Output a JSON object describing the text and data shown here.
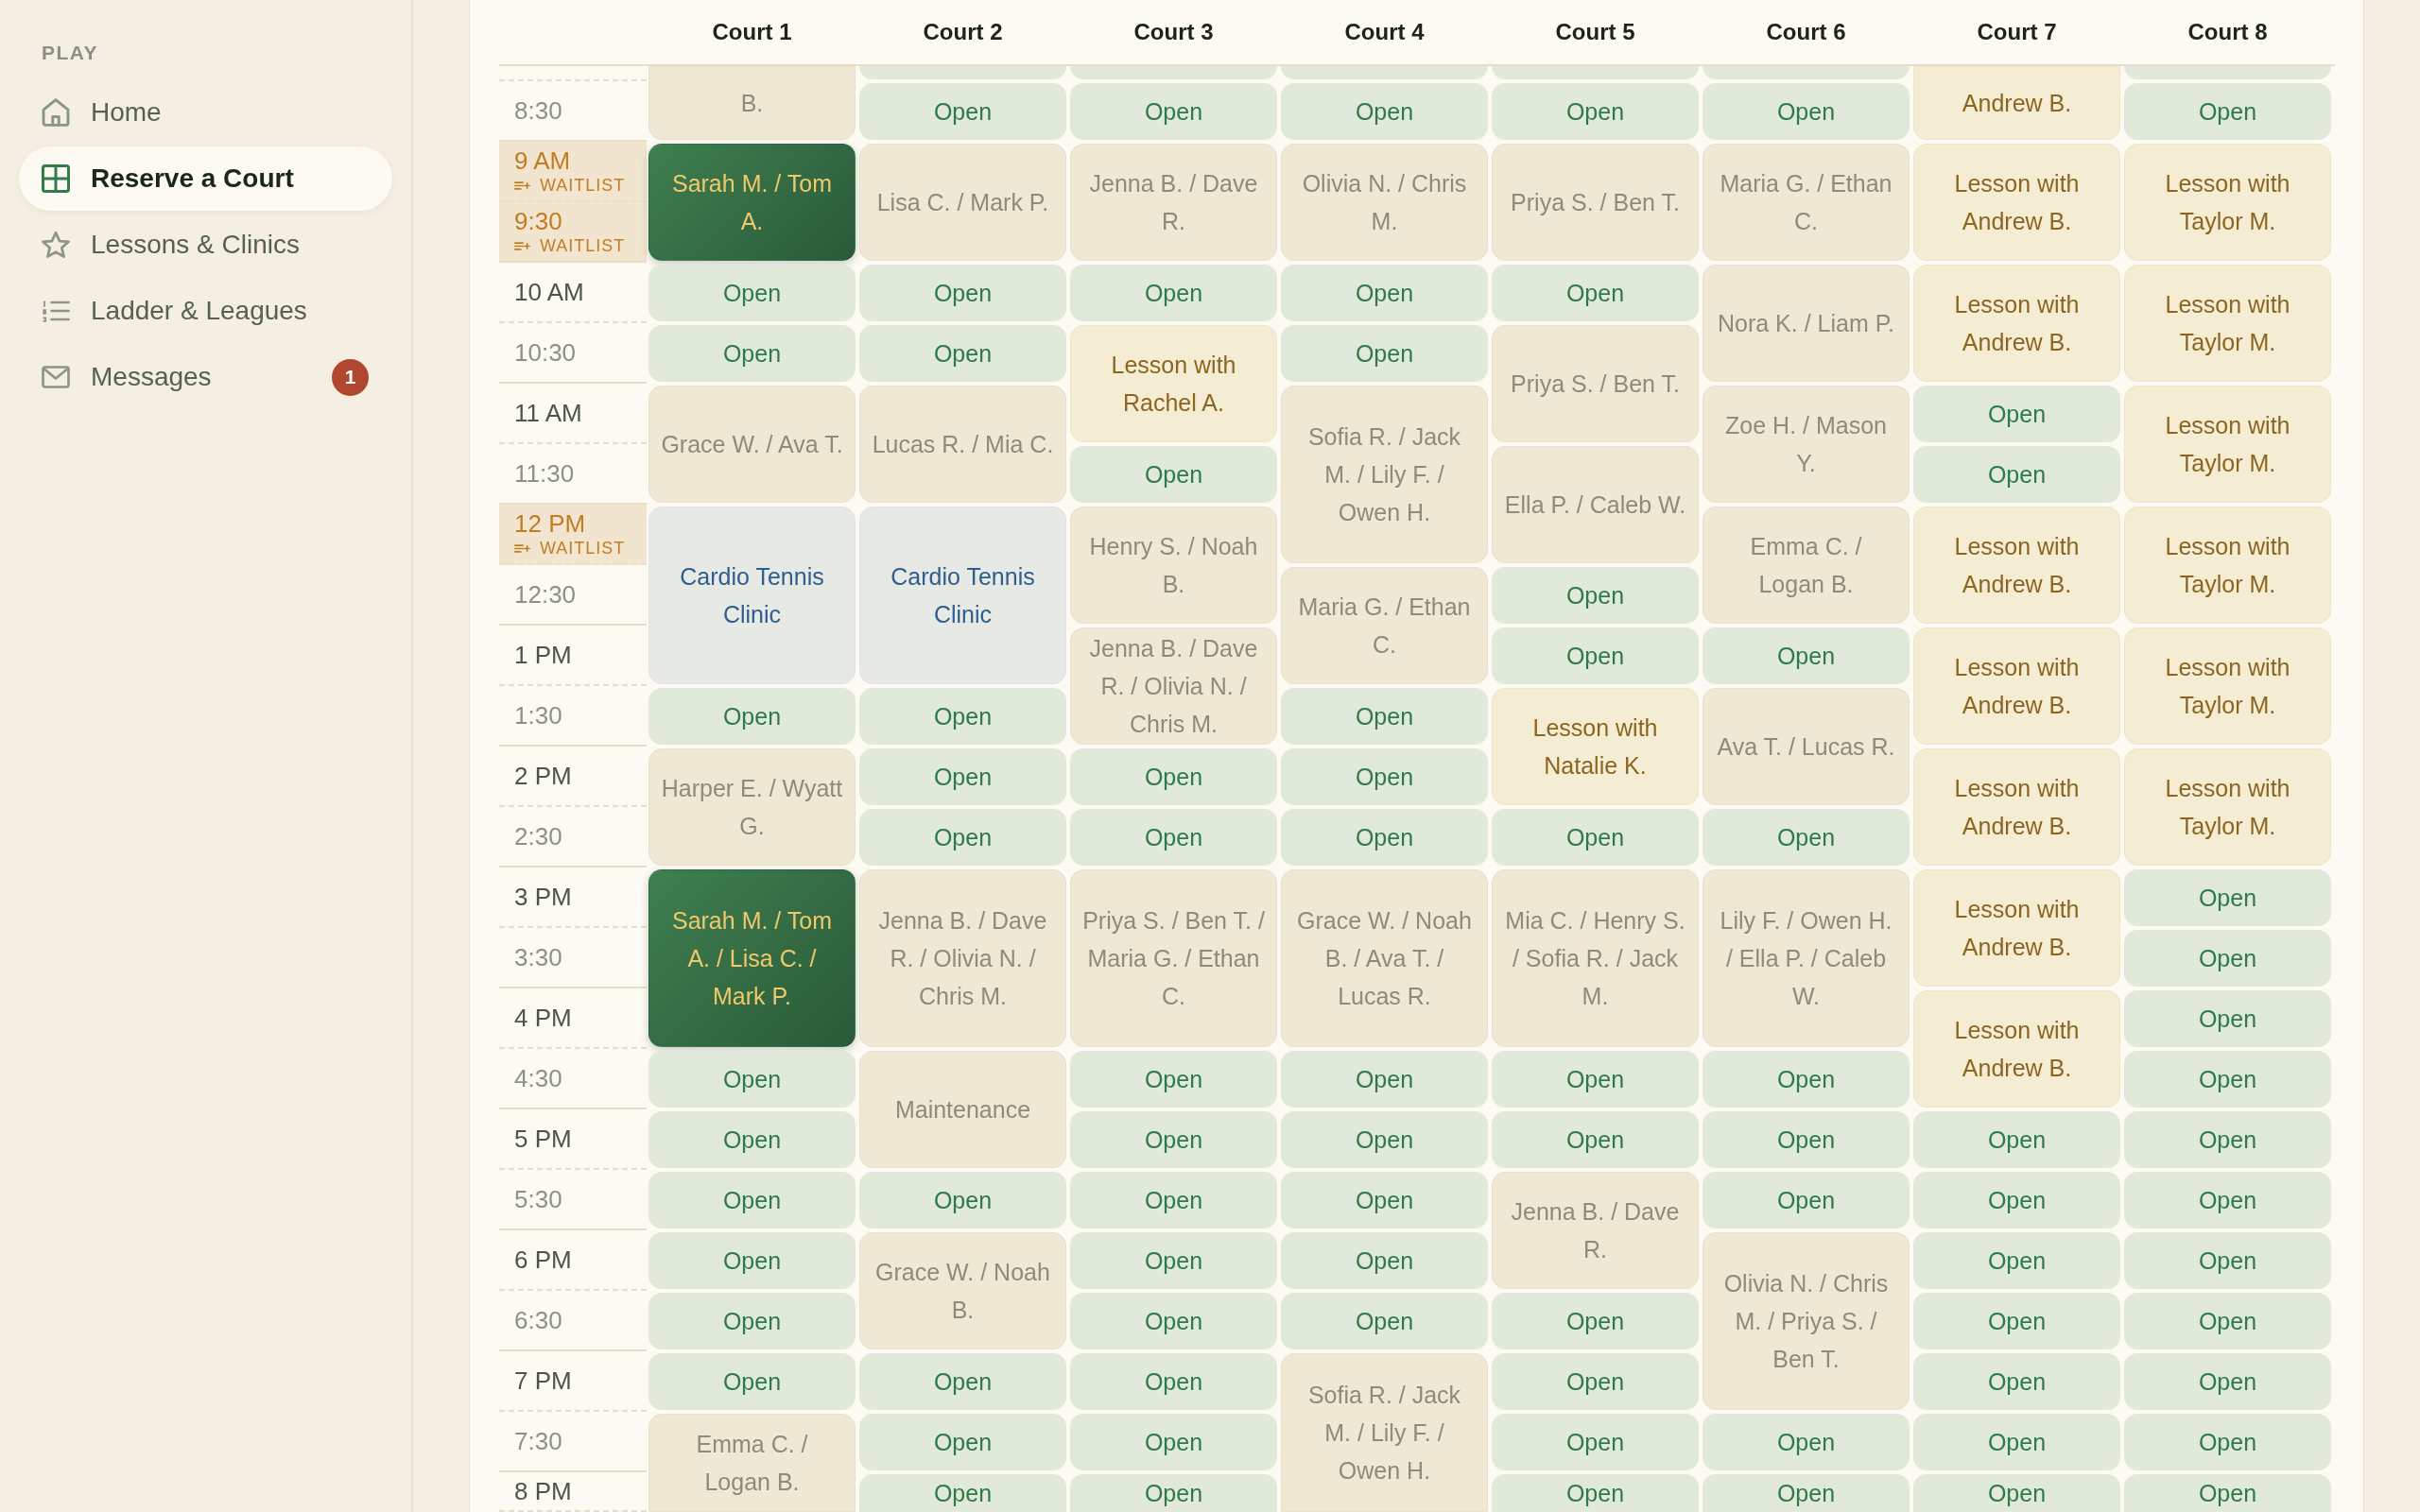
{
  "sidebar": {
    "section_label": "PLAY",
    "items": [
      {
        "label": "Home",
        "selected": false
      },
      {
        "label": "Reserve a Court",
        "selected": true
      },
      {
        "label": "Lessons & Clinics",
        "selected": false
      },
      {
        "label": "Ladder & Leagues",
        "selected": false
      },
      {
        "label": "Messages",
        "selected": false,
        "badge": "1"
      }
    ]
  },
  "schedule": {
    "time_slots": [
      {
        "time": "8:30",
        "kind": "half"
      },
      {
        "time": "9 AM",
        "kind": "hour",
        "waitlist": "WAITLIST"
      },
      {
        "time": "9:30",
        "kind": "half",
        "waitlist": "WAITLIST"
      },
      {
        "time": "10 AM",
        "kind": "hour"
      },
      {
        "time": "10:30",
        "kind": "half"
      },
      {
        "time": "11 AM",
        "kind": "hour"
      },
      {
        "time": "11:30",
        "kind": "half"
      },
      {
        "time": "12 PM",
        "kind": "hour",
        "waitlist": "WAITLIST"
      },
      {
        "time": "12:30",
        "kind": "half"
      },
      {
        "time": "1 PM",
        "kind": "hour"
      },
      {
        "time": "1:30",
        "kind": "half"
      },
      {
        "time": "2 PM",
        "kind": "hour"
      },
      {
        "time": "2:30",
        "kind": "half"
      },
      {
        "time": "3 PM",
        "kind": "hour"
      },
      {
        "time": "3:30",
        "kind": "half"
      },
      {
        "time": "4 PM",
        "kind": "hour"
      },
      {
        "time": "4:30",
        "kind": "half"
      },
      {
        "time": "5 PM",
        "kind": "hour"
      },
      {
        "time": "5:30",
        "kind": "half"
      },
      {
        "time": "6 PM",
        "kind": "hour"
      },
      {
        "time": "6:30",
        "kind": "half"
      },
      {
        "time": "7 PM",
        "kind": "hour"
      },
      {
        "time": "7:30",
        "kind": "half"
      },
      {
        "time": "8 PM",
        "kind": "hour"
      }
    ],
    "courts": [
      {
        "name": "Court 1",
        "slots": [
          {
            "kind": "booked",
            "text": "B."
          },
          {
            "kind": "continued"
          },
          {
            "kind": "mine",
            "text": "Sarah M. / Tom A."
          },
          {
            "kind": "continued"
          },
          {
            "kind": "open",
            "text": "Open"
          },
          {
            "kind": "open",
            "text": "Open"
          },
          {
            "kind": "booked",
            "text": "Grace W. / Ava T."
          },
          {
            "kind": "continued"
          },
          {
            "kind": "clinic",
            "text": "Cardio Tennis Clinic"
          },
          {
            "kind": "continued"
          },
          {
            "kind": "continued"
          },
          {
            "kind": "open",
            "text": "Open"
          },
          {
            "kind": "booked",
            "text": "Harper E. / Wyatt G."
          },
          {
            "kind": "continued"
          },
          {
            "kind": "mine",
            "text": "Sarah M. / Tom A. / Lisa C. / Mark P."
          },
          {
            "kind": "continued"
          },
          {
            "kind": "continued"
          },
          {
            "kind": "open",
            "text": "Open"
          },
          {
            "kind": "open",
            "text": "Open"
          },
          {
            "kind": "open",
            "text": "Open"
          },
          {
            "kind": "open",
            "text": "Open"
          },
          {
            "kind": "open",
            "text": "Open"
          },
          {
            "kind": "open",
            "text": "Open"
          },
          {
            "kind": "booked",
            "text": "Emma C. / Logan B."
          },
          {
            "kind": "continued"
          }
        ]
      },
      {
        "name": "Court 2",
        "slots": [
          {
            "kind": "open"
          },
          {
            "kind": "open",
            "text": "Open"
          },
          {
            "kind": "booked",
            "text": "Lisa C. / Mark P."
          },
          {
            "kind": "continued"
          },
          {
            "kind": "open",
            "text": "Open"
          },
          {
            "kind": "open",
            "text": "Open"
          },
          {
            "kind": "booked",
            "text": "Lucas R. / Mia C."
          },
          {
            "kind": "continued"
          },
          {
            "kind": "clinic",
            "text": "Cardio Tennis Clinic"
          },
          {
            "kind": "continued"
          },
          {
            "kind": "continued"
          },
          {
            "kind": "open",
            "text": "Open"
          },
          {
            "kind": "open",
            "text": "Open"
          },
          {
            "kind": "open",
            "text": "Open"
          },
          {
            "kind": "booked",
            "text": "Jenna B. / Dave R. / Olivia N. / Chris M."
          },
          {
            "kind": "continued"
          },
          {
            "kind": "continued"
          },
          {
            "kind": "maintenance",
            "text": "Maintenance"
          },
          {
            "kind": "continued"
          },
          {
            "kind": "open",
            "text": "Open"
          },
          {
            "kind": "booked",
            "text": "Grace W. / Noah B."
          },
          {
            "kind": "continued"
          },
          {
            "kind": "open",
            "text": "Open"
          },
          {
            "kind": "open",
            "text": "Open"
          },
          {
            "kind": "open",
            "text": "Open"
          }
        ]
      },
      {
        "name": "Court 3",
        "slots": [
          {
            "kind": "open"
          },
          {
            "kind": "open",
            "text": "Open"
          },
          {
            "kind": "booked",
            "text": "Jenna B. / Dave R."
          },
          {
            "kind": "continued"
          },
          {
            "kind": "open",
            "text": "Open"
          },
          {
            "kind": "lesson",
            "text": "Lesson with Rachel A."
          },
          {
            "kind": "continued"
          },
          {
            "kind": "open",
            "text": "Open"
          },
          {
            "kind": "booked",
            "text": "Henry S. / Noah B."
          },
          {
            "kind": "continued"
          },
          {
            "kind": "booked",
            "text": "Jenna B. / Dave R. / Olivia N. / Chris M."
          },
          {
            "kind": "continued"
          },
          {
            "kind": "open",
            "text": "Open"
          },
          {
            "kind": "open",
            "text": "Open"
          },
          {
            "kind": "booked",
            "text": "Priya S. / Ben T. / Maria G. / Ethan C."
          },
          {
            "kind": "continued"
          },
          {
            "kind": "continued"
          },
          {
            "kind": "open",
            "text": "Open"
          },
          {
            "kind": "open",
            "text": "Open"
          },
          {
            "kind": "open",
            "text": "Open"
          },
          {
            "kind": "open",
            "text": "Open"
          },
          {
            "kind": "open",
            "text": "Open"
          },
          {
            "kind": "open",
            "text": "Open"
          },
          {
            "kind": "open",
            "text": "Open"
          },
          {
            "kind": "open",
            "text": "Open"
          }
        ]
      },
      {
        "name": "Court 4",
        "slots": [
          {
            "kind": "open"
          },
          {
            "kind": "open",
            "text": "Open"
          },
          {
            "kind": "booked",
            "text": "Olivia N. / Chris M."
          },
          {
            "kind": "continued"
          },
          {
            "kind": "open",
            "text": "Open"
          },
          {
            "kind": "open",
            "text": "Open"
          },
          {
            "kind": "booked",
            "text": "Sofia R. / Jack M. / Lily F. / Owen H."
          },
          {
            "kind": "continued"
          },
          {
            "kind": "continued"
          },
          {
            "kind": "booked",
            "text": "Maria G. / Ethan C."
          },
          {
            "kind": "continued"
          },
          {
            "kind": "open",
            "text": "Open"
          },
          {
            "kind": "open",
            "text": "Open"
          },
          {
            "kind": "open",
            "text": "Open"
          },
          {
            "kind": "booked",
            "text": "Grace W. / Noah B. / Ava T. / Lucas R."
          },
          {
            "kind": "continued"
          },
          {
            "kind": "continued"
          },
          {
            "kind": "open",
            "text": "Open"
          },
          {
            "kind": "open",
            "text": "Open"
          },
          {
            "kind": "open",
            "text": "Open"
          },
          {
            "kind": "open",
            "text": "Open"
          },
          {
            "kind": "open",
            "text": "Open"
          },
          {
            "kind": "booked",
            "text": "Sofia R. / Jack M. / Lily F. / Owen H."
          },
          {
            "kind": "continued"
          },
          {
            "kind": "continued"
          }
        ]
      },
      {
        "name": "Court 5",
        "slots": [
          {
            "kind": "open"
          },
          {
            "kind": "open",
            "text": "Open"
          },
          {
            "kind": "booked",
            "text": "Priya S. / Ben T."
          },
          {
            "kind": "continued"
          },
          {
            "kind": "open",
            "text": "Open"
          },
          {
            "kind": "booked",
            "text": "Priya S. / Ben T."
          },
          {
            "kind": "continued"
          },
          {
            "kind": "booked",
            "text": "Ella P. / Caleb W."
          },
          {
            "kind": "continued"
          },
          {
            "kind": "open",
            "text": "Open"
          },
          {
            "kind": "open",
            "text": "Open"
          },
          {
            "kind": "lesson",
            "text": "Lesson with Natalie K."
          },
          {
            "kind": "continued"
          },
          {
            "kind": "open",
            "text": "Open"
          },
          {
            "kind": "booked",
            "text": "Mia C. / Henry S. / Sofia R. / Jack M."
          },
          {
            "kind": "continued"
          },
          {
            "kind": "continued"
          },
          {
            "kind": "open",
            "text": "Open"
          },
          {
            "kind": "open",
            "text": "Open"
          },
          {
            "kind": "booked",
            "text": "Jenna B. / Dave R."
          },
          {
            "kind": "continued"
          },
          {
            "kind": "open",
            "text": "Open"
          },
          {
            "kind": "open",
            "text": "Open"
          },
          {
            "kind": "open",
            "text": "Open"
          },
          {
            "kind": "open",
            "text": "Open"
          }
        ]
      },
      {
        "name": "Court 6",
        "slots": [
          {
            "kind": "open"
          },
          {
            "kind": "open",
            "text": "Open"
          },
          {
            "kind": "booked",
            "text": "Maria G. / Ethan C."
          },
          {
            "kind": "continued"
          },
          {
            "kind": "booked",
            "text": "Nora K. / Liam P."
          },
          {
            "kind": "continued"
          },
          {
            "kind": "booked",
            "text": "Zoe H. / Mason Y."
          },
          {
            "kind": "continued"
          },
          {
            "kind": "booked",
            "text": "Emma C. / Logan B."
          },
          {
            "kind": "continued"
          },
          {
            "kind": "open",
            "text": "Open"
          },
          {
            "kind": "booked",
            "text": "Ava T. / Lucas R."
          },
          {
            "kind": "continued"
          },
          {
            "kind": "open",
            "text": "Open"
          },
          {
            "kind": "booked",
            "text": "Lily F. / Owen H. / Ella P. / Caleb W."
          },
          {
            "kind": "continued"
          },
          {
            "kind": "continued"
          },
          {
            "kind": "open",
            "text": "Open"
          },
          {
            "kind": "open",
            "text": "Open"
          },
          {
            "kind": "open",
            "text": "Open"
          },
          {
            "kind": "booked",
            "text": "Olivia N. / Chris M. / Priya S. / Ben T."
          },
          {
            "kind": "continued"
          },
          {
            "kind": "continued"
          },
          {
            "kind": "open",
            "text": "Open"
          },
          {
            "kind": "open",
            "text": "Open"
          }
        ]
      },
      {
        "name": "Court 7",
        "slots": [
          {
            "kind": "lesson",
            "text": "Andrew B."
          },
          {
            "kind": "continued"
          },
          {
            "kind": "lesson",
            "text": "Lesson with Andrew B."
          },
          {
            "kind": "continued"
          },
          {
            "kind": "lesson",
            "text": "Lesson with Andrew B."
          },
          {
            "kind": "continued"
          },
          {
            "kind": "open",
            "text": "Open"
          },
          {
            "kind": "open",
            "text": "Open"
          },
          {
            "kind": "lesson",
            "text": "Lesson with Andrew B."
          },
          {
            "kind": "continued"
          },
          {
            "kind": "lesson",
            "text": "Lesson with Andrew B."
          },
          {
            "kind": "continued"
          },
          {
            "kind": "lesson",
            "text": "Lesson with Andrew B."
          },
          {
            "kind": "continued"
          },
          {
            "kind": "lesson",
            "text": "Lesson with Andrew B."
          },
          {
            "kind": "continued"
          },
          {
            "kind": "lesson",
            "text": "Lesson with Andrew B."
          },
          {
            "kind": "continued"
          },
          {
            "kind": "open",
            "text": "Open"
          },
          {
            "kind": "open",
            "text": "Open"
          },
          {
            "kind": "open",
            "text": "Open"
          },
          {
            "kind": "open",
            "text": "Open"
          },
          {
            "kind": "open",
            "text": "Open"
          },
          {
            "kind": "open",
            "text": "Open"
          },
          {
            "kind": "open",
            "text": "Open"
          }
        ]
      },
      {
        "name": "Court 8",
        "slots": [
          {
            "kind": "open"
          },
          {
            "kind": "open",
            "text": "Open"
          },
          {
            "kind": "lesson",
            "text": "Lesson with Taylor M."
          },
          {
            "kind": "continued"
          },
          {
            "kind": "lesson",
            "text": "Lesson with Taylor M."
          },
          {
            "kind": "continued"
          },
          {
            "kind": "lesson",
            "text": "Lesson with Taylor M."
          },
          {
            "kind": "continued"
          },
          {
            "kind": "lesson",
            "text": "Lesson with Taylor M."
          },
          {
            "kind": "continued"
          },
          {
            "kind": "lesson",
            "text": "Lesson with Taylor M."
          },
          {
            "kind": "continued"
          },
          {
            "kind": "lesson",
            "text": "Lesson with Taylor M."
          },
          {
            "kind": "continued"
          },
          {
            "kind": "open",
            "text": "Open"
          },
          {
            "kind": "open",
            "text": "Open"
          },
          {
            "kind": "open",
            "text": "Open"
          },
          {
            "kind": "open",
            "text": "Open"
          },
          {
            "kind": "open",
            "text": "Open"
          },
          {
            "kind": "open",
            "text": "Open"
          },
          {
            "kind": "open",
            "text": "Open"
          },
          {
            "kind": "open",
            "text": "Open"
          },
          {
            "kind": "open",
            "text": "Open"
          },
          {
            "kind": "open",
            "text": "Open"
          },
          {
            "kind": "open",
            "text": "Open"
          }
        ]
      }
    ]
  }
}
